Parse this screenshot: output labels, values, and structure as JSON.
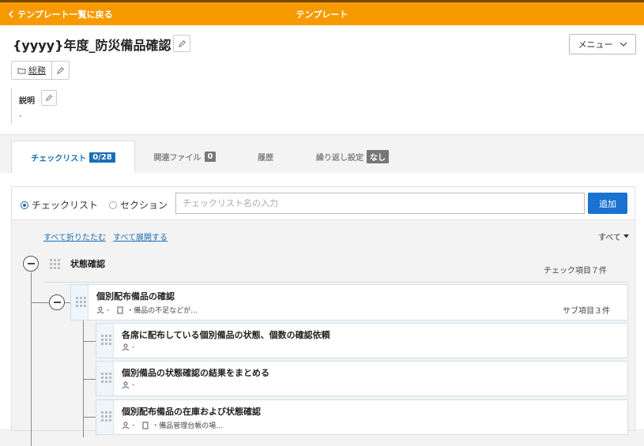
{
  "topbar": {
    "back_label": "テンプレート一覧に戻る",
    "title": "テンプレート"
  },
  "header": {
    "title": "{yyyy}年度_防災備品確認",
    "menu_label": "メニュー",
    "folder_label": "総務",
    "description_label": "説明",
    "description_value": "-"
  },
  "tabs": [
    {
      "label": "チェックリスト",
      "badge": "0/28"
    },
    {
      "label": "関連ファイル",
      "badge": "0"
    },
    {
      "label": "履歴"
    },
    {
      "label": "繰り返し設定",
      "badge": "なし"
    }
  ],
  "input_bar": {
    "radio_checklist": "チェックリスト",
    "radio_section": "セクション",
    "placeholder": "チェックリスト名の入力",
    "add_label": "追加"
  },
  "links": {
    "collapse_all": "すべて折りたたむ",
    "expand_all": "すべて展開する",
    "filter": "すべて"
  },
  "section": {
    "title": "状態確認",
    "count": "チェック項目７件"
  },
  "group": {
    "title": "個別配布備品の確認",
    "assignee": "-",
    "note": "・備品の不足などが…",
    "count": "サブ項目３件"
  },
  "items": [
    {
      "title": "各席に配布している個別備品の状態、個数の確認依頼",
      "assignee": "-"
    },
    {
      "title": "個別備品の状態確認の結果をまとめる",
      "assignee": "-"
    },
    {
      "title": "個別配布備品の在庫および状態確認",
      "assignee": "-",
      "note": "・備品管理台帳の場…"
    }
  ],
  "colors": {
    "accent": "#f79a00",
    "primary": "#1a73d0"
  }
}
